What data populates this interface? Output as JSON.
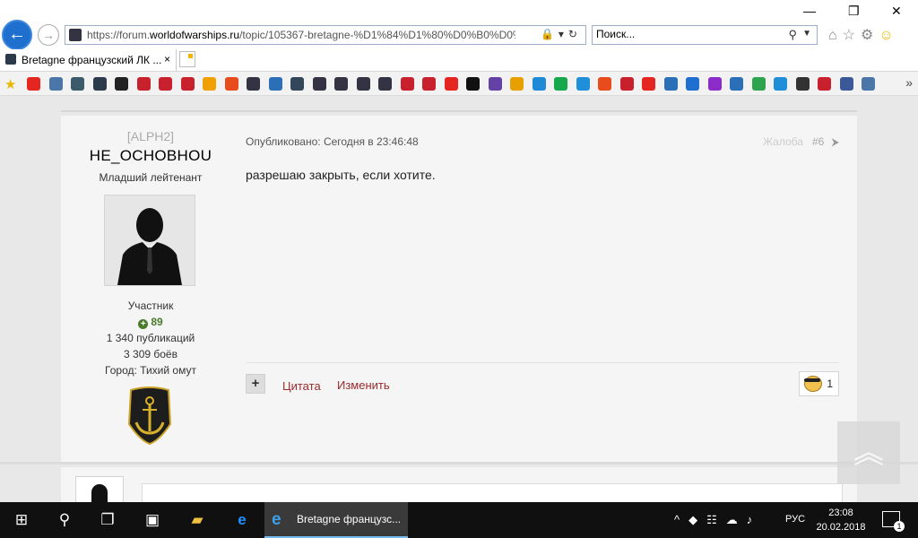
{
  "browser": {
    "url_prefix": "https://forum.",
    "url_domain": "worldofwarships.ru",
    "url_path": "/topic/105367-bretagne-%D1%84%D1%80%D0%B0%D0%BD%",
    "search_value": "Поиск...",
    "tab_title": "Bretagne французский ЛК ...",
    "tab_close": "×",
    "win_min": "—",
    "win_max": "❐",
    "win_close": "✕"
  },
  "favorites": {
    "colors": [
      "#e52620",
      "#4a76a8",
      "#3b5a6a",
      "#2b3b4b",
      "#222",
      "#c8202c",
      "#c8202c",
      "#c8202c",
      "#f0a000",
      "#e84b1c",
      "#334",
      "#2a6fb8",
      "#33475b",
      "#334",
      "#334",
      "#334",
      "#334",
      "#c8202c",
      "#c8202c",
      "#e52620",
      "#111",
      "#6441a4",
      "#e8a000",
      "#1f8bd8",
      "#15a84d",
      "#1e8fd8",
      "#e84b1c",
      "#c8202c",
      "#e52620",
      "#2a6fb8",
      "#1e6fd0",
      "#8b2bc8",
      "#2a6fb8",
      "#2ea44f",
      "#1e8fd8",
      "#333",
      "#c8202c",
      "#3b5998",
      "#4a76a8"
    ]
  },
  "post": {
    "clan": "[ALPH2]",
    "username": "HE_OCHOBHOU",
    "rank": "Младший лейтенант",
    "group": "Участник",
    "reputation": "89",
    "posts_count": "1 340 публикаций",
    "battles": "3 309 боёв",
    "city": "Город: Тихий омут",
    "posted": "Опубликовано: Сегодня в 23:46:48",
    "report": "Жалоба",
    "post_number": "#6",
    "body": "разрешаю закрыть, если хотите.",
    "quote_label": "Цитата",
    "edit_label": "Изменить",
    "reaction_count": "1"
  },
  "taskbar": {
    "app_title": "Bretagne французс...",
    "lang": "РУС",
    "time": "23:08",
    "date": "20.02.2018",
    "notifications": "1"
  }
}
